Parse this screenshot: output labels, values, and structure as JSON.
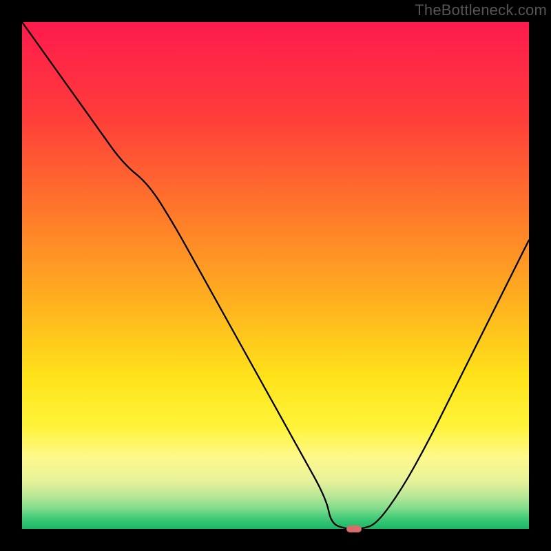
{
  "watermark": "TheBottleneck.com",
  "chart_data": {
    "type": "line",
    "title": "",
    "xlabel": "",
    "ylabel": "",
    "xlim": [
      0,
      100
    ],
    "ylim": [
      0,
      100
    ],
    "x": [
      0,
      5,
      10,
      15,
      20,
      25,
      30,
      35,
      40,
      45,
      50,
      55,
      60,
      61,
      64,
      67,
      70,
      75,
      80,
      85,
      90,
      95,
      100
    ],
    "values": [
      100,
      93,
      86,
      79,
      72,
      68,
      60,
      51,
      42,
      33,
      24,
      15,
      6,
      1,
      0,
      0,
      1,
      8,
      17,
      27,
      37,
      47,
      57
    ],
    "marker_x": 65.5,
    "marker_y": 0,
    "gradient_stops": [
      {
        "offset": 0.0,
        "color": "#ff1a4d"
      },
      {
        "offset": 0.18,
        "color": "#ff3b3b"
      },
      {
        "offset": 0.38,
        "color": "#ff7a2a"
      },
      {
        "offset": 0.55,
        "color": "#ffb01f"
      },
      {
        "offset": 0.7,
        "color": "#ffe21a"
      },
      {
        "offset": 0.8,
        "color": "#fff43a"
      },
      {
        "offset": 0.86,
        "color": "#fdf98c"
      },
      {
        "offset": 0.905,
        "color": "#e8f29a"
      },
      {
        "offset": 0.935,
        "color": "#b7e897"
      },
      {
        "offset": 0.96,
        "color": "#7fdc8c"
      },
      {
        "offset": 0.98,
        "color": "#3ec977"
      },
      {
        "offset": 1.0,
        "color": "#18b765"
      }
    ]
  }
}
